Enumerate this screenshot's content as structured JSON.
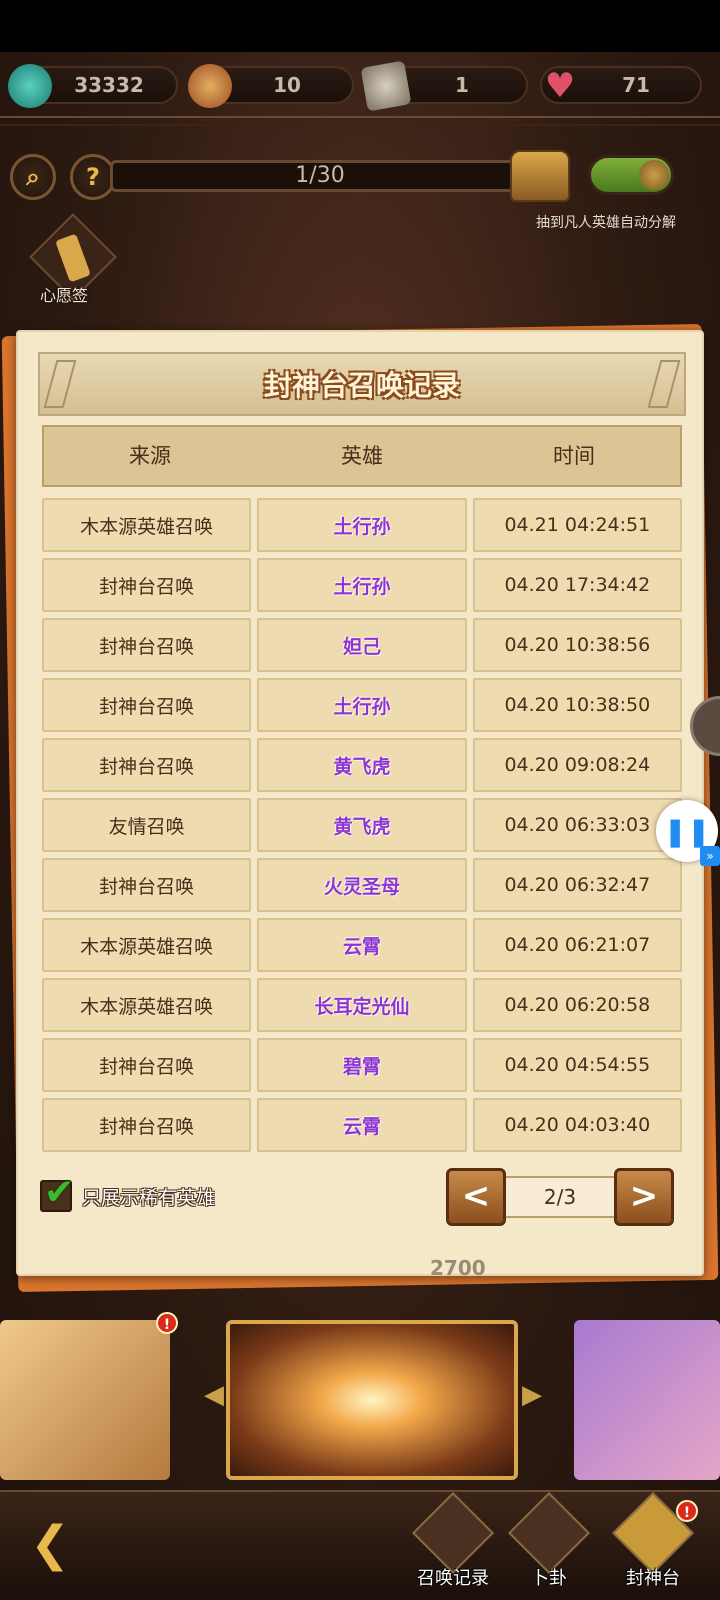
{
  "resources": [
    {
      "icon": "jade-coin-icon",
      "value": "33332"
    },
    {
      "icon": "hero-token-icon",
      "value": "10"
    },
    {
      "icon": "scroll-ticket-icon",
      "value": "1"
    },
    {
      "icon": "heart-icon",
      "value": "71"
    }
  ],
  "progress": {
    "label": "1/30",
    "value": 1,
    "max": 30
  },
  "toggle": {
    "on": true,
    "label": "抽到凡人英雄自动分解"
  },
  "wish": {
    "label": "心愿签"
  },
  "modal": {
    "title": "封神台召唤记录",
    "columns": [
      "来源",
      "英雄",
      "时间"
    ],
    "rows": [
      {
        "source": "木本源英雄召唤",
        "hero": "土行孙",
        "time": "04.21 04:24:51"
      },
      {
        "source": "封神台召唤",
        "hero": "土行孙",
        "time": "04.20 17:34:42"
      },
      {
        "source": "封神台召唤",
        "hero": "妲己",
        "time": "04.20 10:38:56"
      },
      {
        "source": "封神台召唤",
        "hero": "土行孙",
        "time": "04.20 10:38:50"
      },
      {
        "source": "封神台召唤",
        "hero": "黄飞虎",
        "time": "04.20 09:08:24"
      },
      {
        "source": "友情召唤",
        "hero": "黄飞虎",
        "time": "04.20 06:33:03"
      },
      {
        "source": "封神台召唤",
        "hero": "火灵圣母",
        "time": "04.20 06:32:47"
      },
      {
        "source": "木本源英雄召唤",
        "hero": "云霄",
        "time": "04.20 06:21:07"
      },
      {
        "source": "木本源英雄召唤",
        "hero": "长耳定光仙",
        "time": "04.20 06:20:58"
      },
      {
        "source": "封神台召唤",
        "hero": "碧霄",
        "time": "04.20 04:54:55"
      },
      {
        "source": "封神台召唤",
        "hero": "云霄",
        "time": "04.20 04:03:40"
      }
    ],
    "filter_label": "只展示稀有英雄",
    "filter_checked": true,
    "page": "2/3",
    "prev": "<",
    "next": ">"
  },
  "behind_value": "2700",
  "nav": [
    {
      "label": "召唤记录",
      "icon": "record-book-icon"
    },
    {
      "label": "卜卦",
      "icon": "yin-yang-icon"
    },
    {
      "label": "封神台",
      "icon": "scroll-altar-icon"
    }
  ],
  "badges": {
    "alert": "!"
  },
  "colors": {
    "hero_text": "#8b35d6",
    "panel_bg": "#f5e8c8",
    "cell_bg": "#efdbb0",
    "toggle_on": "#6a9a2c"
  }
}
